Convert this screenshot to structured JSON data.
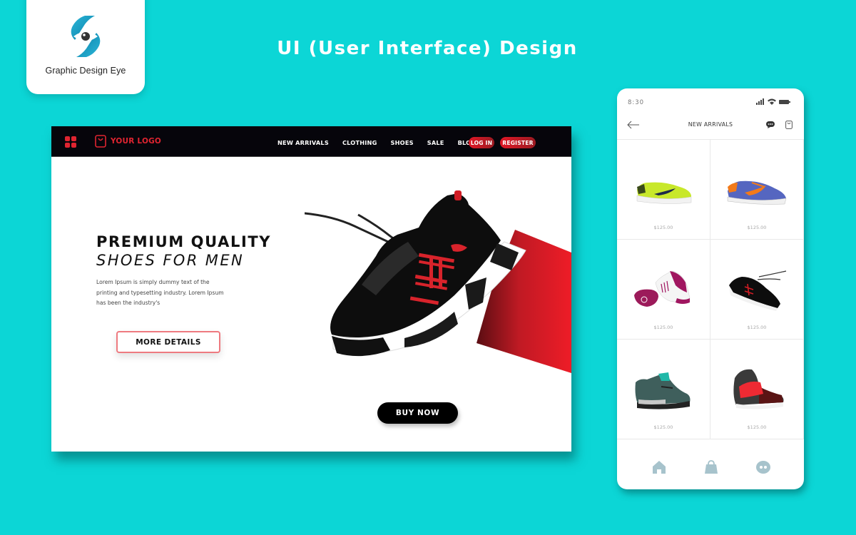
{
  "brand": {
    "name": "Graphic Design Eye",
    "logo_icon": "swirl-eye-logo",
    "color": "#1ea7c9"
  },
  "page_title": "UI (User Interface) Design",
  "colors": {
    "background": "#0cd6d6",
    "accent_red": "#e02430",
    "nav_dark": "#06050b",
    "phone_icon": "#a7c3cc"
  },
  "desktop": {
    "nav": {
      "menu_icon": "grid-menu-icon",
      "logo_icon": "shopping-bag-icon",
      "logo_text": "YOUR LOGO",
      "links": [
        "NEW ARRIVALS",
        "CLOTHING",
        "SHOES",
        "SALE",
        "BLOG"
      ],
      "login_label": "LOG IN",
      "register_label": "REGISTER"
    },
    "hero": {
      "title": "PREMIUM QUALITY",
      "subtitle": "SHOES FOR MEN",
      "description": "Lorem Ipsum is simply dummy text of the printing and typesetting industry. Lorem Ipsum has been the industry's",
      "more_details_label": "MORE DETAILS",
      "buy_now_label": "BUY NOW",
      "image": "black-red-sneaker"
    }
  },
  "phone": {
    "status": {
      "time": "8:30",
      "icons": [
        "signal-icon",
        "wifi-icon",
        "battery-icon"
      ]
    },
    "header": {
      "back_icon": "back-arrow-icon",
      "title": "NEW ARRIVALS",
      "chat_icon": "chat-icon",
      "bag_icon": "bag-icon"
    },
    "products": [
      {
        "image": "lime-green-sneaker",
        "price": "$125.00"
      },
      {
        "image": "blue-orange-running-shoe",
        "price": "$125.00"
      },
      {
        "image": "magenta-white-sneakers",
        "price": "$125.00"
      },
      {
        "image": "black-red-sneaker",
        "price": "$125.00"
      },
      {
        "image": "teal-basketball-shoe",
        "price": "$125.00"
      },
      {
        "image": "red-black-high-top",
        "price": "$125.00"
      }
    ],
    "tabbar": [
      "home-icon",
      "shopping-bag-icon",
      "chat-icon"
    ]
  }
}
